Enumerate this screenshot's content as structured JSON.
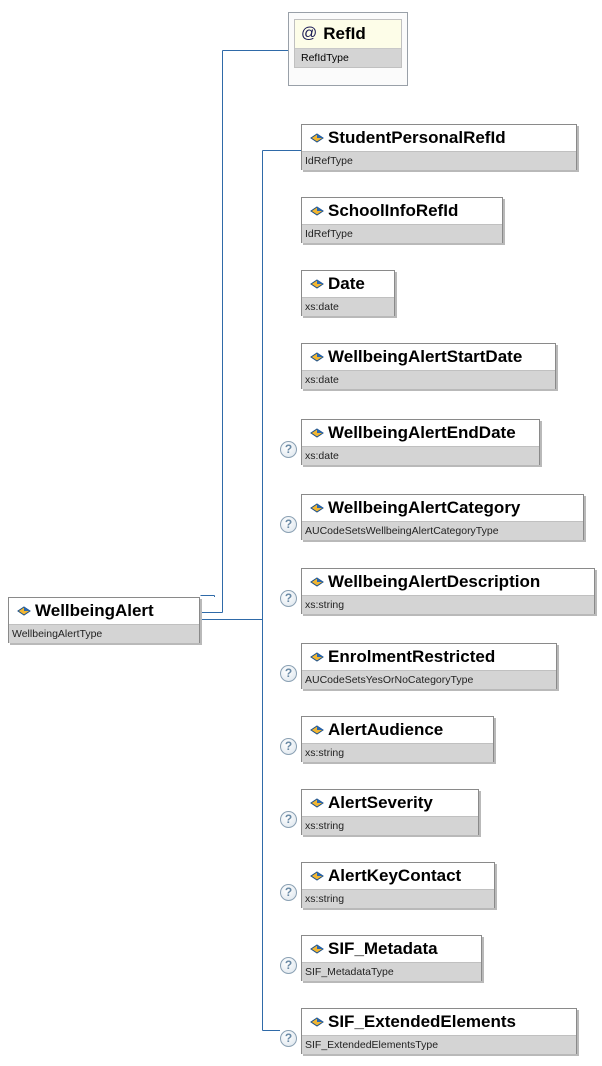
{
  "root": {
    "name": "WellbeingAlert",
    "type": "WellbeingAlertType"
  },
  "attribute": {
    "symbol": "@",
    "name": "RefId",
    "type": "RefIdType"
  },
  "optional_marker": "?",
  "elements": [
    {
      "name": "StudentPersonalRefId",
      "type": "IdRefType",
      "optional": false
    },
    {
      "name": "SchoolInfoRefId",
      "type": "IdRefType",
      "optional": false
    },
    {
      "name": "Date",
      "type": "xs:date",
      "optional": false
    },
    {
      "name": "WellbeingAlertStartDate",
      "type": "xs:date",
      "optional": false
    },
    {
      "name": "WellbeingAlertEndDate",
      "type": "xs:date",
      "optional": true
    },
    {
      "name": "WellbeingAlertCategory",
      "type": "AUCodeSetsWellbeingAlertCategoryType",
      "optional": true
    },
    {
      "name": "WellbeingAlertDescription",
      "type": "xs:string",
      "optional": true
    },
    {
      "name": "EnrolmentRestricted",
      "type": "AUCodeSetsYesOrNoCategoryType",
      "optional": true
    },
    {
      "name": "AlertAudience",
      "type": "xs:string",
      "optional": true
    },
    {
      "name": "AlertSeverity",
      "type": "xs:string",
      "optional": true
    },
    {
      "name": "AlertKeyContact",
      "type": "xs:string",
      "optional": true
    },
    {
      "name": "SIF_Metadata",
      "type": "SIF_MetadataType",
      "optional": true
    },
    {
      "name": "SIF_ExtendedElements",
      "type": "SIF_ExtendedElementsType",
      "optional": true
    }
  ],
  "colors": {
    "line": "#2f6aa8",
    "border": "#8a8a8a",
    "type_bg": "#d4d4d4",
    "attr_bg": "#fdfde8"
  },
  "icons": {
    "element": "element-diamond-icon",
    "optional": "question-mark-icon"
  }
}
